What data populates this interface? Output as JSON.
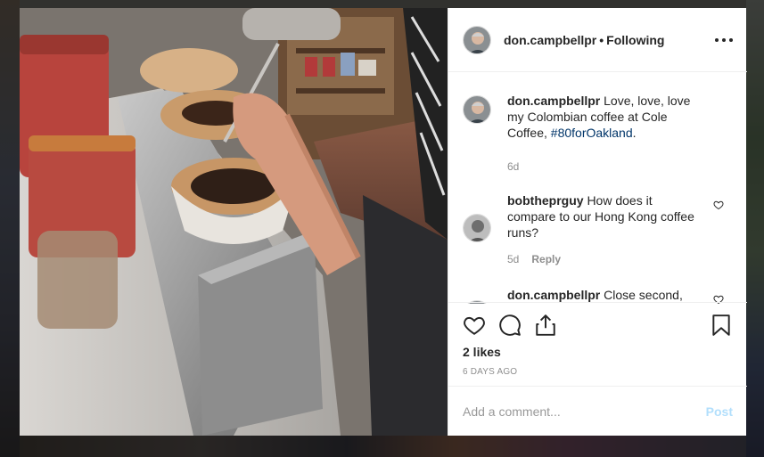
{
  "post": {
    "username": "don.campbellpr",
    "separator": "•",
    "follow_status": "Following",
    "more_icon": "more-horizontal-icon"
  },
  "comments": [
    {
      "username": "don.campbellpr",
      "text": "Love, love, love my Colombian coffee at Cole Coffee,",
      "hashtag": "#80forOakland",
      "trailing": ".",
      "age": "6d",
      "reply_label": ""
    },
    {
      "username": "bobtheprguy",
      "text": "How does it compare to our Hong Kong coffee runs?",
      "age": "5d",
      "reply_label": "Reply"
    },
    {
      "username": "don.campbellpr",
      "text": "Close second,"
    }
  ],
  "actions": {
    "icons": [
      "heart-icon",
      "comment-icon",
      "share-icon",
      "bookmark-icon"
    ],
    "likes": "2 likes",
    "timestamp": "6 DAYS AGO"
  },
  "composer": {
    "placeholder": "Add a comment...",
    "post_label": "Post"
  },
  "colors": {
    "hashtag": "#003569",
    "post_disabled": "#b2dffc",
    "meta_gray": "#8e8e8e"
  }
}
